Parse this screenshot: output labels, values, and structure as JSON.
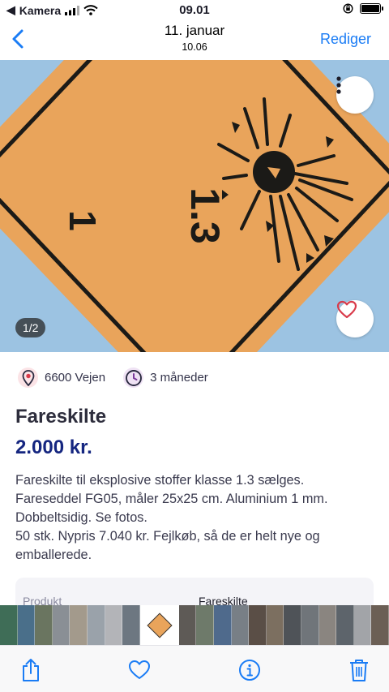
{
  "status_bar": {
    "back_app": "Kamera",
    "time": "09.01"
  },
  "nav": {
    "title": "11. januar",
    "subtitle": "10.06",
    "edit_label": "Rediger"
  },
  "photo": {
    "counter": "1/2",
    "sign_left_number": "1",
    "sign_center_number": "1.3"
  },
  "meta": {
    "location": "6600 Vejen",
    "age": "3 måneder"
  },
  "listing": {
    "title": "Fareskilte",
    "price": "2.000 kr.",
    "description": [
      "Fareskilte til eksplosive stoffer klasse 1.3 sælges.",
      "Fareseddel FG05, måler 25x25 cm. Aluminium 1 mm.",
      "Dobbeltsidig. Se fotos.",
      "50 stk. Nypris 7.040 kr. Fejlkøb, så de er helt nye og",
      "emballerede."
    ],
    "details": {
      "label": "Produkt",
      "value": "Fareskilte"
    }
  },
  "thumbnails": [
    {
      "color": "#3f6d57"
    },
    {
      "color": "#4a6f8a"
    },
    {
      "color": "#6a7560"
    },
    {
      "color": "#8a8f95"
    },
    {
      "color": "#a39a8c"
    },
    {
      "color": "#9aa2aa"
    },
    {
      "color": "#b3b4b8"
    },
    {
      "color": "#6d7781"
    },
    {
      "color": "#ffffff",
      "selected": true
    },
    {
      "color": "#5e5a56"
    },
    {
      "color": "#6e7a6a"
    },
    {
      "color": "#4f6a8c"
    },
    {
      "color": "#787f86"
    },
    {
      "color": "#5a4e46"
    },
    {
      "color": "#7c6f60"
    },
    {
      "color": "#4f5358"
    },
    {
      "color": "#70757a"
    },
    {
      "color": "#8a8580"
    },
    {
      "color": "#5d646b"
    },
    {
      "color": "#a2a4a8"
    },
    {
      "color": "#6b5f55"
    }
  ],
  "colors": {
    "accent": "#1a7cf5",
    "price": "#152680",
    "sign_orange": "#e9a45b",
    "sky": "#9cc3e2"
  }
}
